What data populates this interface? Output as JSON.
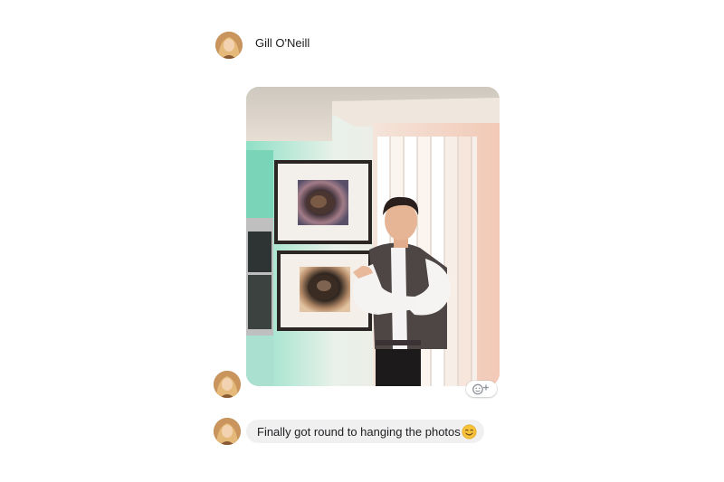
{
  "conversation": {
    "sender": {
      "name": "Gill O'Neill",
      "avatar_icon": "profile-photo-avatar"
    },
    "messages": [
      {
        "type": "photo",
        "react_icon": "add-reaction-icon"
      },
      {
        "type": "text",
        "text": "Finally got round to hanging the photos",
        "emoji": "😊",
        "emoji_icon": "smiling-face-emoji"
      }
    ]
  },
  "colors": {
    "bubble_background": "#f1f0f0",
    "text": "#1c1e21",
    "background": "#ffffff"
  }
}
